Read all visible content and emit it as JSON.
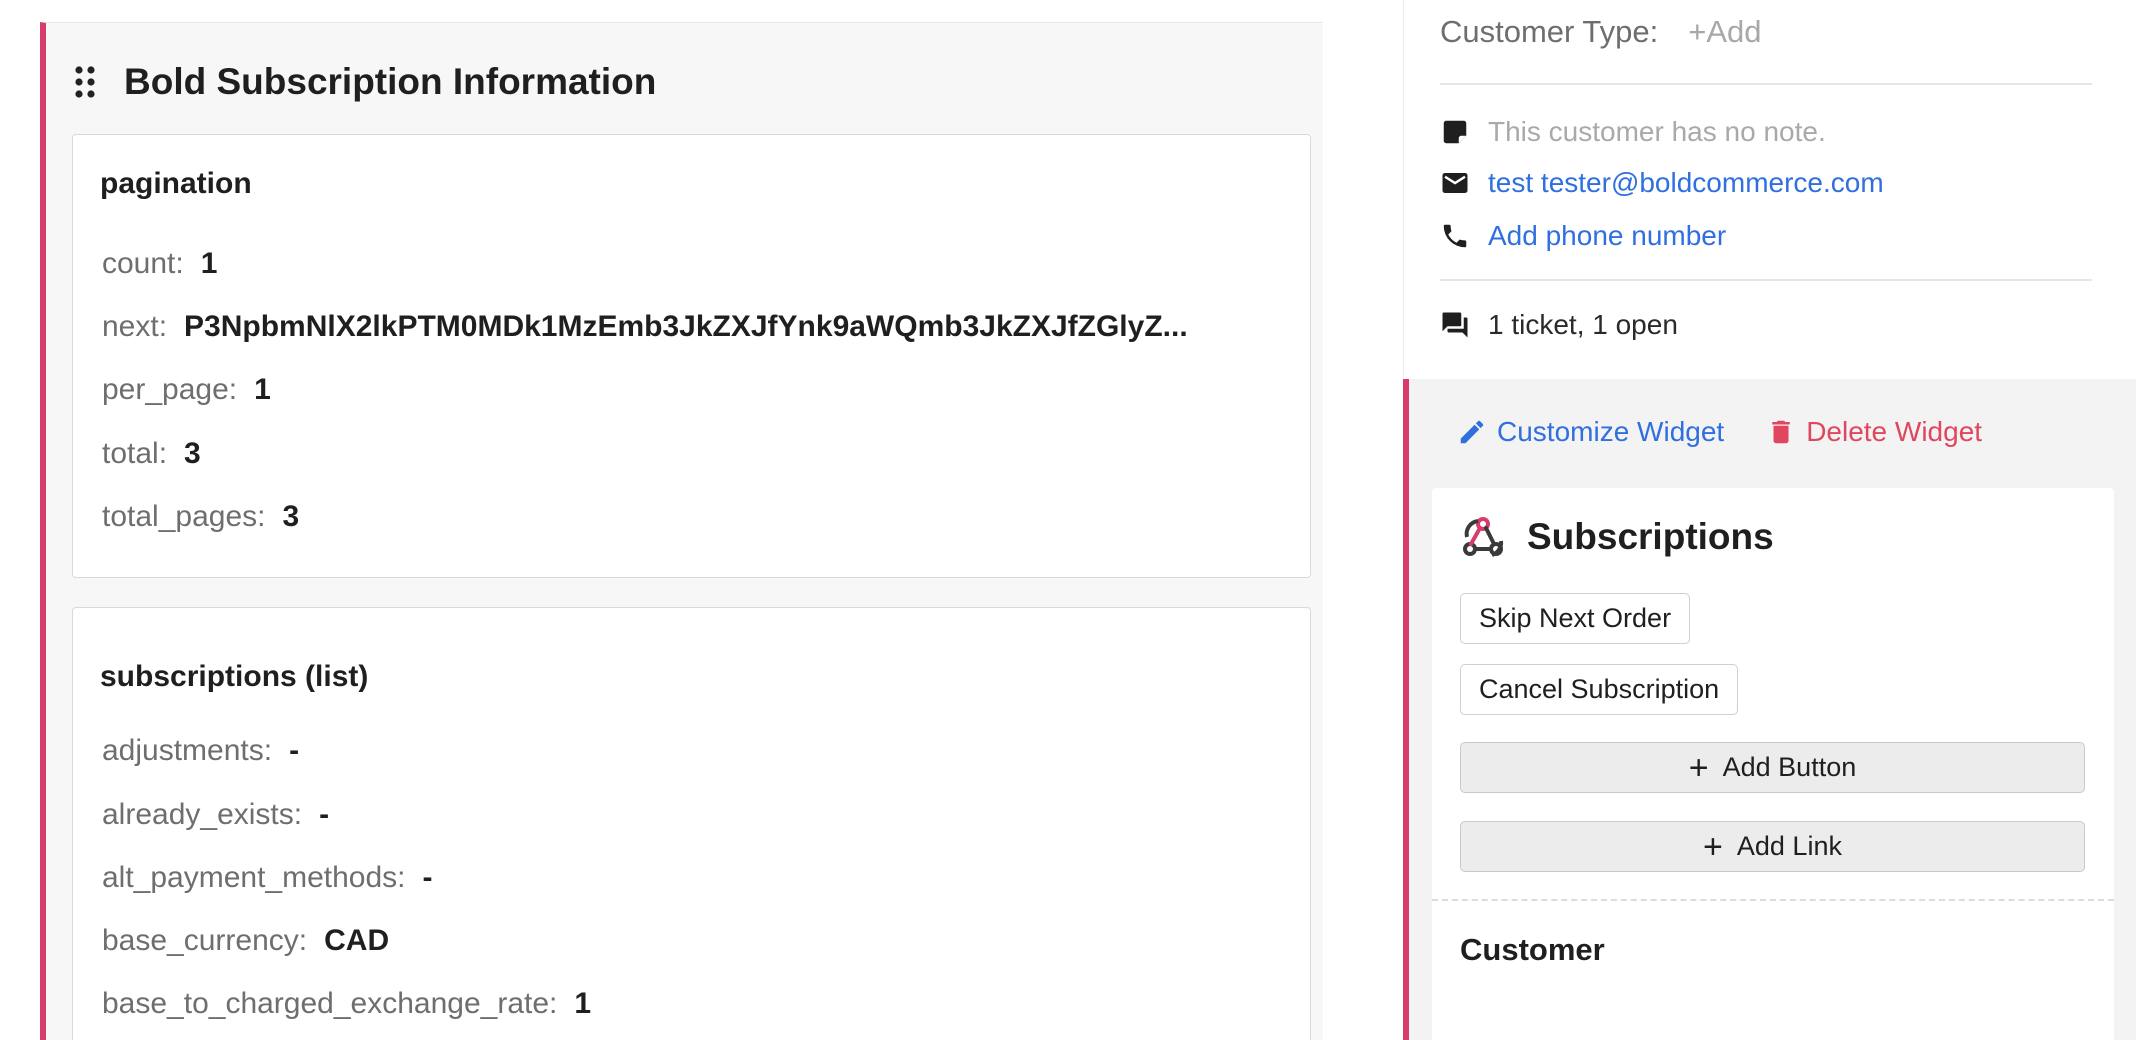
{
  "left": {
    "title": "Bold Subscription Information",
    "pagination": {
      "title": "pagination",
      "rows": [
        {
          "key": "count:",
          "value": "1"
        },
        {
          "key": "next:",
          "value": "P3NpbmNlX2lkPTM0MDk1MzEmb3JkZXJfYnk9aWQmb3JkZXJfZGlyZ..."
        },
        {
          "key": "per_page:",
          "value": "1"
        },
        {
          "key": "total:",
          "value": "3"
        },
        {
          "key": "total_pages:",
          "value": "3"
        }
      ]
    },
    "subscriptions": {
      "title": "subscriptions (list)",
      "rows": [
        {
          "key": "adjustments:",
          "value": "-"
        },
        {
          "key": "already_exists:",
          "value": "-"
        },
        {
          "key": "alt_payment_methods:",
          "value": "-"
        },
        {
          "key": "base_currency:",
          "value": "CAD"
        },
        {
          "key": "base_to_charged_exchange_rate:",
          "value": "1"
        }
      ]
    }
  },
  "customer_info": {
    "type_label": "Customer Type:",
    "type_add": "+Add",
    "note": "This customer has no note.",
    "email": "test tester@boldcommerce.com",
    "phone": "Add phone number",
    "tickets": "1 ticket, 1 open"
  },
  "widget": {
    "customize_label": "Customize Widget",
    "delete_label": "Delete Widget",
    "title": "Subscriptions",
    "buttons": [
      "Skip Next Order",
      "Cancel Subscription"
    ],
    "add_button_label": "Add Button",
    "add_link_label": "Add Link",
    "section_title": "Customer"
  },
  "colors": {
    "accent_bar": "#d63d6a",
    "link": "#2f6fdf",
    "danger": "#e0475f"
  }
}
